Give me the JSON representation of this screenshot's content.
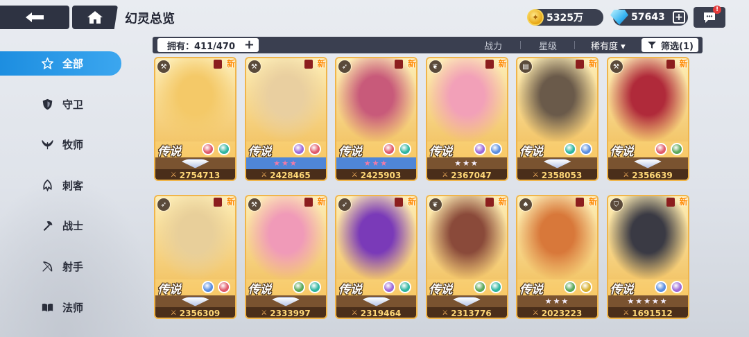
{
  "header": {
    "title": "幻灵总览",
    "gold": "5325万",
    "gems": "57643",
    "chat_badge": "!"
  },
  "sidebar": {
    "items": [
      {
        "label": "全部",
        "icon": "all-star-icon",
        "active": true
      },
      {
        "label": "守卫",
        "icon": "shield-icon",
        "active": false
      },
      {
        "label": "牧师",
        "icon": "wings-icon",
        "active": false
      },
      {
        "label": "刺客",
        "icon": "dagger-icon",
        "active": false
      },
      {
        "label": "战士",
        "icon": "axe-icon",
        "active": false
      },
      {
        "label": "射手",
        "icon": "bow-icon",
        "active": false
      },
      {
        "label": "法师",
        "icon": "book-icon",
        "active": false
      }
    ]
  },
  "filterbar": {
    "owned": "拥有：411/470",
    "sort_power": "战力",
    "sort_star": "星级",
    "sort_rarity": "稀有度 ▾",
    "filter": "筛选(1)"
  },
  "cards": [
    {
      "power": "2754713",
      "rarity": "传说",
      "bar": "rank",
      "elements": [
        "#e05a6a",
        "#2fb5a0"
      ],
      "class_icon": "axe-icon",
      "hue": "#f4c968"
    },
    {
      "power": "2428465",
      "rarity": "传说",
      "bar": "blue",
      "stars": "★★★",
      "elements": [
        "#9d6ad8",
        "#e05a6a"
      ],
      "class_icon": "axe-icon",
      "hue": "#e9cfa0"
    },
    {
      "power": "2425903",
      "rarity": "传说",
      "bar": "blue",
      "stars": "★★★",
      "elements": [
        "#e05a6a",
        "#2fb5a0"
      ],
      "class_icon": "bow-icon",
      "hue": "#c85a7a"
    },
    {
      "power": "2367047",
      "rarity": "传说",
      "bar": "gold",
      "stars": "★★★",
      "elements": [
        "#9d6ad8",
        "#5a8ee0"
      ],
      "class_icon": "wings-icon",
      "hue": "#f2a0b8"
    },
    {
      "power": "2358053",
      "rarity": "传说",
      "bar": "rank",
      "elements": [
        "#2fb5a0",
        "#5a8ee0"
      ],
      "class_icon": "book-icon",
      "hue": "#6a5a4a"
    },
    {
      "power": "2356639",
      "rarity": "传说",
      "bar": "rank",
      "elements": [
        "#e05a6a",
        "#5aa85a"
      ],
      "class_icon": "axe-icon",
      "hue": "#b02a3a"
    },
    {
      "power": "2356309",
      "rarity": "传说",
      "bar": "rank",
      "elements": [
        "#5a8ee0",
        "#e05a6a"
      ],
      "class_icon": "bow-icon",
      "hue": "#e8cf9a"
    },
    {
      "power": "2333997",
      "rarity": "传说",
      "bar": "rank",
      "elements": [
        "#5aa85a",
        "#2fb5a0"
      ],
      "class_icon": "axe-icon",
      "hue": "#f09ab8"
    },
    {
      "power": "2319464",
      "rarity": "传说",
      "bar": "rank",
      "elements": [
        "#9d6ad8",
        "#2fb5a0"
      ],
      "class_icon": "bow-icon",
      "hue": "#7a3ab8"
    },
    {
      "power": "2313776",
      "rarity": "传说",
      "bar": "rank",
      "elements": [
        "#5aa85a",
        "#2fb5a0"
      ],
      "class_icon": "wings-icon",
      "hue": "#8a4a3a"
    },
    {
      "power": "2023223",
      "rarity": "传说",
      "bar": "gold",
      "stars": "★★★",
      "elements": [
        "#5aa85a",
        "#d8b030"
      ],
      "class_icon": "dagger-icon",
      "hue": "#d8783a"
    },
    {
      "power": "1691512",
      "rarity": "传说",
      "bar": "gold",
      "stars": "★★★★★",
      "elements": [
        "#5a8ee0",
        "#9d6ad8"
      ],
      "class_icon": "shield-icon",
      "hue": "#3a3a44"
    }
  ],
  "new_tag": "新"
}
